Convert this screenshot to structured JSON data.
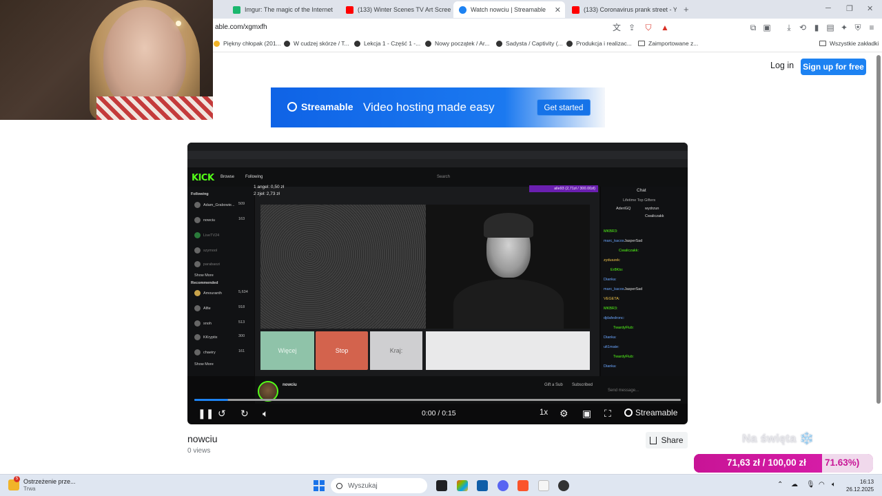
{
  "browser": {
    "tabs": [
      {
        "label": "Imgur: The magic of the Internet",
        "icon": "imgur-icon",
        "color": "#1bb76e"
      },
      {
        "label": "(133) Winter Scenes TV Art Screensa",
        "icon": "youtube-icon",
        "color": "#ff0000"
      },
      {
        "label": "Watch nowciu | Streamable",
        "icon": "streamable-icon",
        "color": "#1d82f2",
        "active": true
      },
      {
        "label": "(133) Coronavirus prank street - YouT",
        "icon": "youtube-icon",
        "color": "#ff0000"
      }
    ],
    "url": "able.com/xgmxfh",
    "bookmarks": [
      "Piękny chłopak (201...",
      "W cudzej skórze / T...",
      "Lekcja 1 - Część 1 -...",
      "Nowy początek / Ar...",
      "Sadysta / Captivity (...",
      "Produkcja i realizac...",
      "Zaimportowane z...",
      "Wszystkie zakładki"
    ],
    "toolbar_badge_counts": [
      "3",
      "1"
    ]
  },
  "header": {
    "login_label": "Log in",
    "signup_label": "Sign up for free"
  },
  "banner": {
    "logo_text": "Streamable",
    "tagline": "Video hosting made easy",
    "cta_label": "Get started"
  },
  "embedded_stream": {
    "logo": "KICK",
    "nav": [
      "Browse",
      "Following"
    ],
    "search_placeholder": "Search",
    "following_header": "Following",
    "following": [
      {
        "name": "Adam_Grabowie...",
        "sub": "Travel & Outdoors",
        "count": "509"
      },
      {
        "name": "nowciu",
        "sub": "Other, Watch Party",
        "count": "163"
      },
      {
        "name": "LiveTV24",
        "sub": "",
        "count": ""
      },
      {
        "name": "szymool",
        "sub": "",
        "count": ""
      },
      {
        "name": "parabaozi",
        "sub": "",
        "count": ""
      }
    ],
    "show_more": "Show More",
    "recommended_header": "Recommended",
    "recommended": [
      {
        "name": "Amouranth",
        "sub": "Just Chatting",
        "count": "5,634"
      },
      {
        "name": "Alfie",
        "sub": "Old School RuneS...",
        "count": "918"
      },
      {
        "name": "snoh",
        "sub": "Just Chatting",
        "count": "513"
      },
      {
        "name": "KKryptix",
        "sub": "Grand Theft Auto...",
        "count": "300"
      },
      {
        "name": "chaeiry",
        "sub": "Just Chatting",
        "count": "161"
      }
    ],
    "money_line1": "1 angel: 0,50 zł",
    "money_line2": "2 zjeł: 2,73 zł",
    "purple_bar": "alle93 (2,71zł / 300.00zł)",
    "buttons": {
      "more": "Więcej",
      "stop": "Stop",
      "kraj": "Kraj:"
    },
    "chat_title": "Chat",
    "gifters_title": "Lifetime Top Gifters",
    "gifters": [
      "AderiGQ",
      "wydrzun",
      "Cwaliczakk"
    ],
    "chat_lines": [
      {
        "user": "MKBR3:",
        "color": "#53fc18"
      },
      {
        "user": "marc_kacos",
        "text": "JasperSad",
        "color": "#6ba6ff"
      },
      {
        "user": "Cwaliczakk:",
        "color": "#53fc18"
      },
      {
        "user": "zyduszek:",
        "color": "#f3c64b"
      },
      {
        "user": "Er8Kto:",
        "color": "#53fc18"
      },
      {
        "user": "Dianka:",
        "color": "#6ba6ff"
      },
      {
        "user": "marc_kacos",
        "text": "JasperSad",
        "color": "#6ba6ff"
      },
      {
        "user": "VEGETA:",
        "color": "#f3c64b"
      },
      {
        "user": "MKBR3:",
        "color": "#53fc18"
      },
      {
        "user": "djdafedronc:",
        "color": "#6ba6ff"
      },
      {
        "user": "TwardyFlub:",
        "color": "#53fc18"
      },
      {
        "user": "Dianka:",
        "color": "#6ba6ff"
      },
      {
        "user": "ult1mate:",
        "color": "#6ba6ff"
      },
      {
        "user": "TwardyFlub:",
        "color": "#53fc18"
      },
      {
        "user": "Dianka:",
        "color": "#6ba6ff"
      }
    ],
    "streamer_name": "nowciu",
    "gift_sub": "Gift a Sub",
    "subscribed": "Subscribed",
    "send_message": "Send message..."
  },
  "player": {
    "timecode": "0:00 / 0:15",
    "speed": "1x",
    "brand": "Streamable",
    "progress": 0.07
  },
  "video": {
    "title": "nowciu",
    "views": "0 views",
    "share_label": "Share"
  },
  "overlay": {
    "holiday": "Na święta ❄️",
    "goal_current": "71,63 zł",
    "goal_target": "100,00 zł",
    "goal_percent": "71.63%)",
    "goal_fraction": 0.7163
  },
  "taskbar": {
    "notification_title": "Ostrzeżenie prze...",
    "notification_sub": "Trwa",
    "notification_badge": "5",
    "search_placeholder": "Wyszukaj",
    "time": "16:13",
    "date": "26.12.2025"
  }
}
